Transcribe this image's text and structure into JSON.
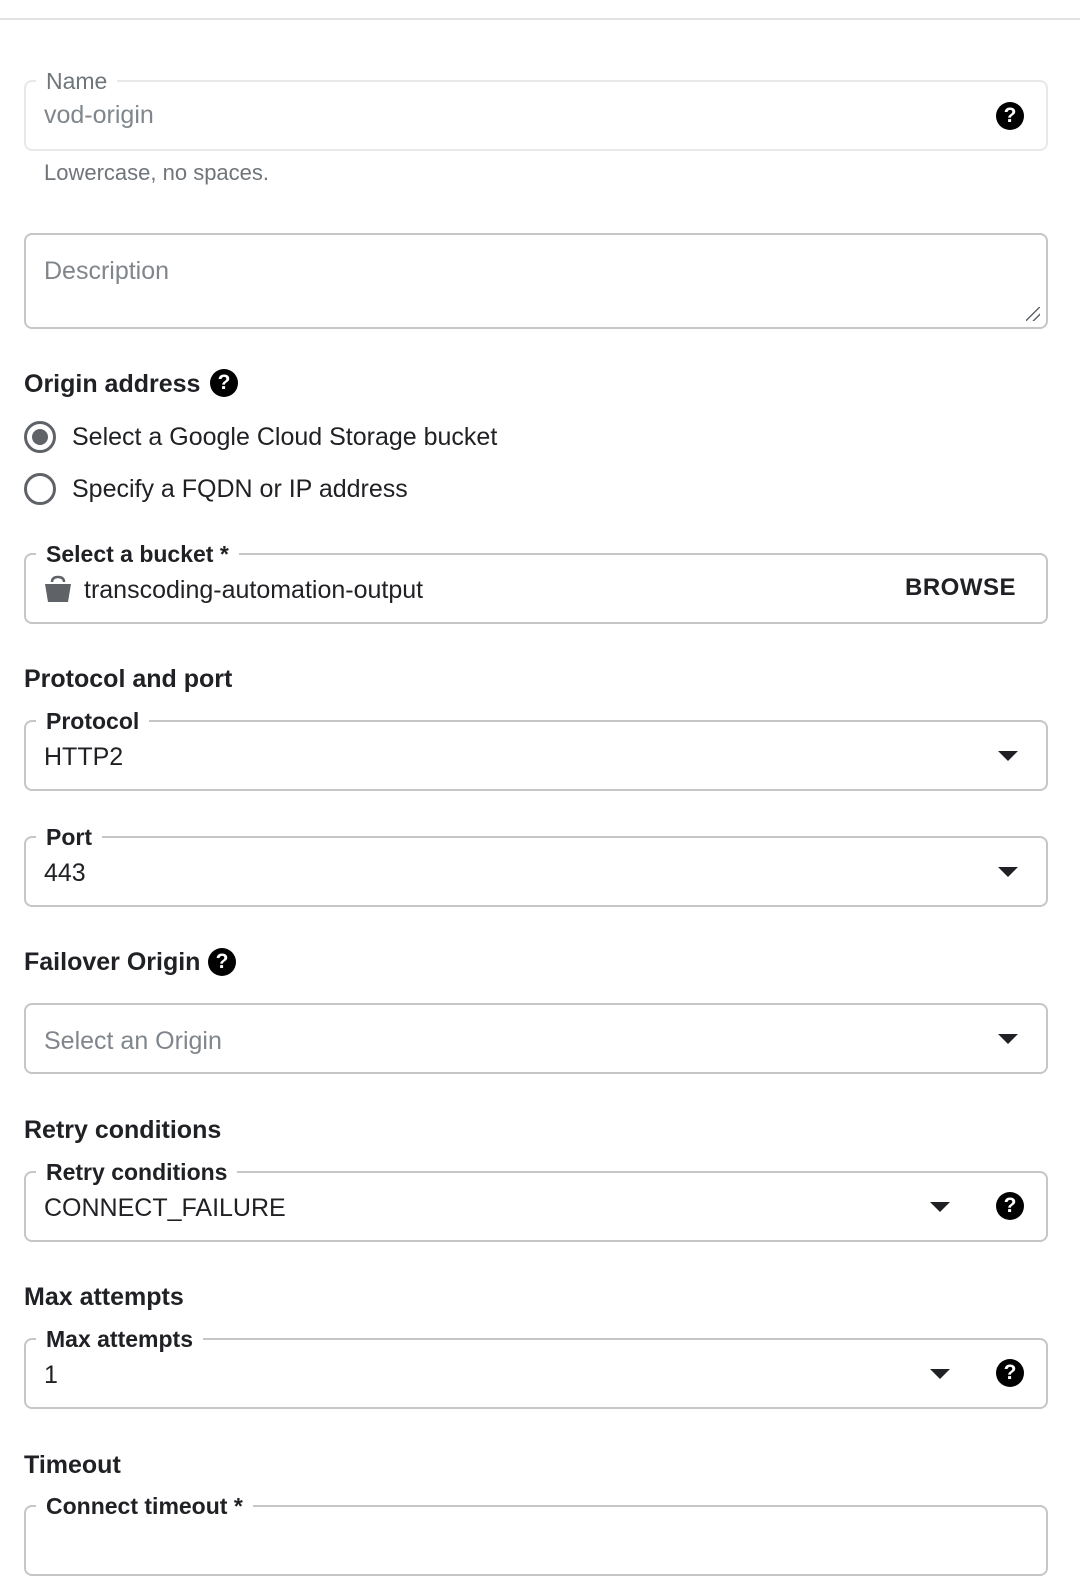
{
  "name_field": {
    "label": "Name",
    "value": "vod-origin",
    "hint": "Lowercase, no spaces."
  },
  "description_field": {
    "placeholder": "Description"
  },
  "origin_address": {
    "heading": "Origin address",
    "options": [
      {
        "label": "Select a Google Cloud Storage bucket",
        "selected": true
      },
      {
        "label": "Specify a FQDN or IP address",
        "selected": false
      }
    ],
    "bucket": {
      "label": "Select a bucket *",
      "value": "transcoding-automation-output",
      "browse_label": "BROWSE"
    }
  },
  "protocol_and_port": {
    "heading": "Protocol and port",
    "protocol": {
      "label": "Protocol",
      "value": "HTTP2"
    },
    "port": {
      "label": "Port",
      "value": "443"
    }
  },
  "failover_origin": {
    "heading": "Failover Origin",
    "placeholder": "Select an Origin"
  },
  "retry_conditions": {
    "heading": "Retry conditions",
    "label": "Retry conditions",
    "value": "CONNECT_FAILURE"
  },
  "max_attempts": {
    "heading": "Max attempts",
    "label": "Max attempts",
    "value": "1"
  },
  "timeout": {
    "heading": "Timeout",
    "connect_timeout_label": "Connect timeout *"
  },
  "icons": {
    "help": "?"
  }
}
